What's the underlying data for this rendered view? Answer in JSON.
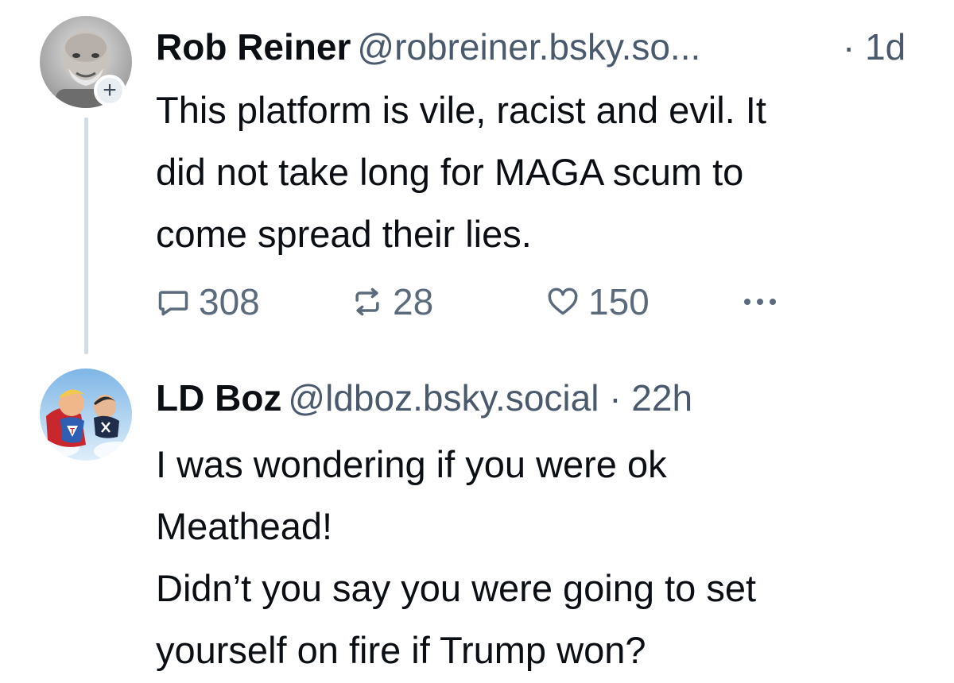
{
  "posts": [
    {
      "author_name": "Rob Reiner",
      "author_handle": "@robreiner.bsky.so...",
      "time": "· 1d",
      "text_lines": [
        "This platform is vile, racist and evil. It",
        "did not take long for MAGA scum to",
        "come spread their lies."
      ],
      "follow_badge": "+",
      "reply_count": "308",
      "repost_count": "28",
      "like_count": "150",
      "icons": {
        "reply": "reply-bubble-icon",
        "repost": "repost-arrows-icon",
        "like": "heart-icon",
        "more": "more-dots-icon"
      }
    },
    {
      "author_name": "LD Boz",
      "author_handle": "@ldboz.bsky.social",
      "time": "· 22h",
      "text_lines": [
        "I was wondering if you were ok",
        "Meathead!",
        "Didn’t you say you were going to set",
        "yourself on fire if Trump won?"
      ]
    }
  ],
  "colors": {
    "text_primary": "#0b0f14",
    "text_secondary": "#4a5a6c",
    "action_gray": "#5b6b7c",
    "thread_line": "#d4dbe2"
  }
}
